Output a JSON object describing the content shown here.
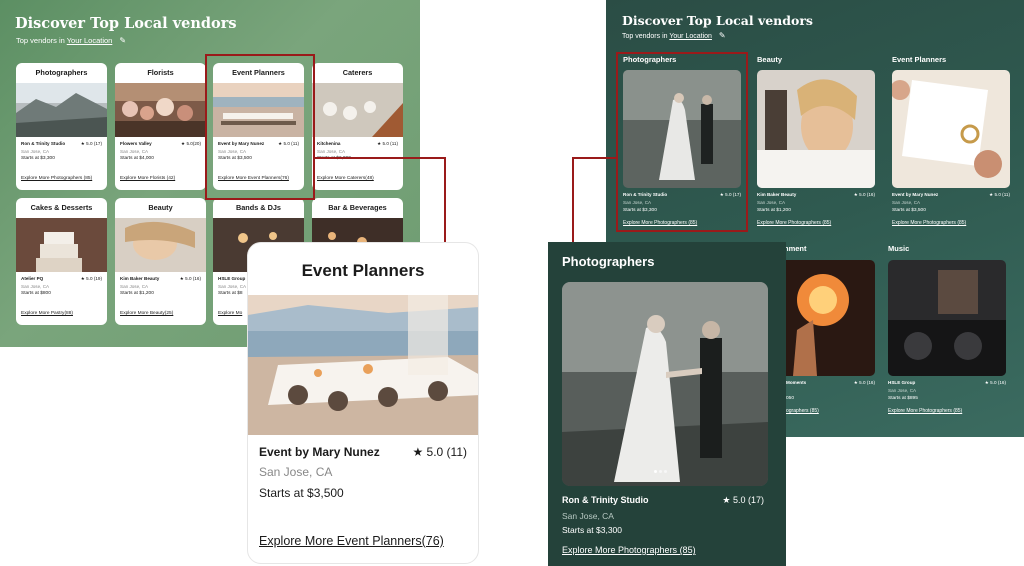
{
  "left_panel": {
    "title": "Discover Top Local vendors",
    "subtitle_prefix": "Top vendors in",
    "location_link": "Your Location",
    "cards": [
      {
        "category": "Photographers",
        "vendor": "Ron & Trinity Studio",
        "rating": "★ 5.0 (17)",
        "location": "San  Jose, CA",
        "price": "Starts at  $3,300",
        "more": "Explore More Photographers (85)"
      },
      {
        "category": "Florists",
        "vendor": "Flowers Valley",
        "rating": "★ 5.0(20)",
        "location": "San  Jose, CA",
        "price": "Starts at  $4,000",
        "more": "Explore More Florists (42)"
      },
      {
        "category": "Event Planners",
        "vendor": "Event by Mary Nunez",
        "rating": "★ 5.0 (11)",
        "location": "San  Jose, CA",
        "price": "Starts at  $3,500",
        "more": "Explore More Event Planners(76)"
      },
      {
        "category": "Caterers",
        "vendor": "Kitchenina",
        "rating": "★ 5.0 (11)",
        "location": "San  Jose, CA",
        "price": "Starts at  $2,000",
        "more": "Explore More Caterers(48)"
      },
      {
        "category": "Cakes & Desserts",
        "vendor": "Atelier PQ",
        "rating": "★ 5.0 (19)",
        "location": "San  Jose, CA",
        "price": "Starts at  $800",
        "more": "Explore More Pastry(88)"
      },
      {
        "category": "Beauty",
        "vendor": "Kim Baker Beauty",
        "rating": "★ 5.0 (16)",
        "location": "San  Jose, CA",
        "price": "Starts at  $1,200",
        "more": "Explore More Beauty(25)"
      },
      {
        "category": "Bands & DJs",
        "vendor": "HSLE Group",
        "rating": "",
        "location": "San  Jose, CA",
        "price": "Starts at  $8",
        "more": "Explore Mo"
      },
      {
        "category": "Bar & Beverages",
        "vendor": "",
        "rating": "",
        "location": "",
        "price": "",
        "more": ""
      }
    ]
  },
  "right_panel": {
    "title": "Discover Top Local vendors",
    "subtitle_prefix": "Top vendors in",
    "location_link": "Your Location",
    "cards": [
      {
        "category": "Photographers",
        "vendor": "Ron & Trinity Studio",
        "rating": "★ 5.0 (17)",
        "location": "San  Jose, CA",
        "price": "Starts at  $3,300",
        "more": "Explore More Photographers (85)"
      },
      {
        "category": "Beauty",
        "vendor": "Kim Baker Beauty",
        "rating": "★ 5.0 (16)",
        "location": "San  Jose, CA",
        "price": "Starts at  $1,200",
        "more": "Explore More Photographers (85)"
      },
      {
        "category": "Event Planners",
        "vendor": "Event by Mary Nunez",
        "rating": "★ 5.0 (11)",
        "location": "San  Jose, CA",
        "price": "Starts at  $3,500",
        "more": "Explore More Photographers (85)"
      },
      {
        "category": "nment",
        "vendor": "Moments",
        "rating": "★ 5.0 (16)",
        "location": "",
        "price": "050",
        "more": "ographers (85)"
      },
      {
        "category": "Music",
        "vendor": "HSLE Group",
        "rating": "★ 5.0 (16)",
        "location": "San  Jose, CA",
        "price": "Starts at  $895",
        "more": "Explore More Photographers (85)"
      }
    ]
  },
  "zoom_event_planners": {
    "category": "Event Planners",
    "vendor": "Event by Mary Nunez",
    "rating": "★ 5.0 (11)",
    "location": "San  Jose, CA",
    "price": "Starts at  $3,500",
    "more": "Explore More Event Planners(76)"
  },
  "zoom_photographers": {
    "category": "Photographers",
    "vendor": "Ron & Trinity Studio",
    "rating": "★ 5.0 (17)",
    "location": "San  Jose, CA",
    "price": "Starts at  $3,300",
    "more": "Explore More Photographers (85)"
  },
  "colors": {
    "left_panel_green": "#6e9c71",
    "right_panel_teal": "#2f5a50",
    "highlight_red": "#9a1a1a"
  }
}
